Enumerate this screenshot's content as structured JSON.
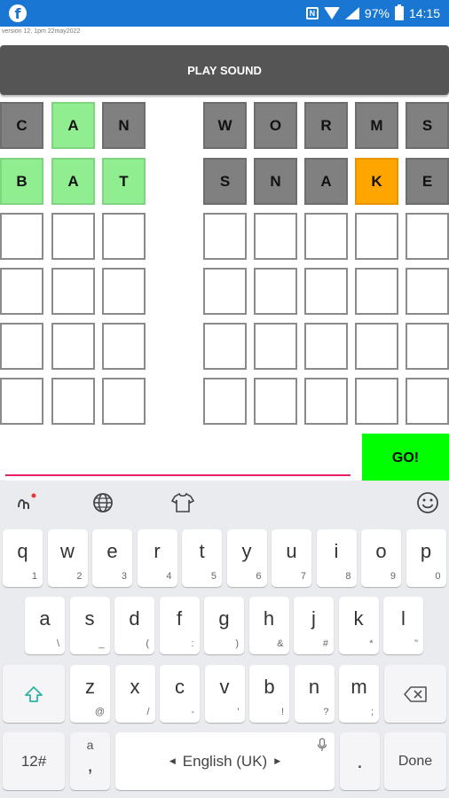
{
  "status": {
    "app_icon": "facebook-icon",
    "battery": "97%",
    "time": "14:15"
  },
  "version": "version 12, 1pm 22may2022",
  "play_label": "PLAY SOUND",
  "left_grid": [
    [
      {
        "l": "C",
        "c": "gray"
      },
      {
        "l": "A",
        "c": "green"
      },
      {
        "l": "N",
        "c": "gray"
      }
    ],
    [
      {
        "l": "B",
        "c": "green"
      },
      {
        "l": "A",
        "c": "green"
      },
      {
        "l": "T",
        "c": "green"
      }
    ],
    [
      {
        "l": "",
        "c": "empty"
      },
      {
        "l": "",
        "c": "empty"
      },
      {
        "l": "",
        "c": "empty"
      }
    ],
    [
      {
        "l": "",
        "c": "empty"
      },
      {
        "l": "",
        "c": "empty"
      },
      {
        "l": "",
        "c": "empty"
      }
    ],
    [
      {
        "l": "",
        "c": "empty"
      },
      {
        "l": "",
        "c": "empty"
      },
      {
        "l": "",
        "c": "empty"
      }
    ],
    [
      {
        "l": "",
        "c": "empty"
      },
      {
        "l": "",
        "c": "empty"
      },
      {
        "l": "",
        "c": "empty"
      }
    ]
  ],
  "right_grid": [
    [
      {
        "l": "W",
        "c": "gray"
      },
      {
        "l": "O",
        "c": "gray"
      },
      {
        "l": "R",
        "c": "gray"
      },
      {
        "l": "M",
        "c": "gray"
      },
      {
        "l": "S",
        "c": "gray"
      }
    ],
    [
      {
        "l": "S",
        "c": "gray"
      },
      {
        "l": "N",
        "c": "gray"
      },
      {
        "l": "A",
        "c": "gray"
      },
      {
        "l": "K",
        "c": "orange"
      },
      {
        "l": "E",
        "c": "gray"
      }
    ],
    [
      {
        "l": "",
        "c": "empty"
      },
      {
        "l": "",
        "c": "empty"
      },
      {
        "l": "",
        "c": "empty"
      },
      {
        "l": "",
        "c": "empty"
      },
      {
        "l": "",
        "c": "empty"
      }
    ],
    [
      {
        "l": "",
        "c": "empty"
      },
      {
        "l": "",
        "c": "empty"
      },
      {
        "l": "",
        "c": "empty"
      },
      {
        "l": "",
        "c": "empty"
      },
      {
        "l": "",
        "c": "empty"
      }
    ],
    [
      {
        "l": "",
        "c": "empty"
      },
      {
        "l": "",
        "c": "empty"
      },
      {
        "l": "",
        "c": "empty"
      },
      {
        "l": "",
        "c": "empty"
      },
      {
        "l": "",
        "c": "empty"
      }
    ],
    [
      {
        "l": "",
        "c": "empty"
      },
      {
        "l": "",
        "c": "empty"
      },
      {
        "l": "",
        "c": "empty"
      },
      {
        "l": "",
        "c": "empty"
      },
      {
        "l": "",
        "c": "empty"
      }
    ]
  ],
  "go_label": "GO!",
  "colors": {
    "gray": "#808080",
    "green": "#90ee90",
    "orange": "#ffa500",
    "go": "#00ff00",
    "status_bar": "#1976d2"
  },
  "keyboard": {
    "toolbar": [
      "touch-input-icon",
      "globe-icon",
      "theme-shirt-icon",
      "emoji-icon"
    ],
    "row1": [
      [
        "q",
        "1"
      ],
      [
        "w",
        "2"
      ],
      [
        "e",
        "3"
      ],
      [
        "r",
        "4"
      ],
      [
        "t",
        "5"
      ],
      [
        "y",
        "6"
      ],
      [
        "u",
        "7"
      ],
      [
        "i",
        "8"
      ],
      [
        "o",
        "9"
      ],
      [
        "p",
        "0"
      ]
    ],
    "row2": [
      [
        "a",
        "\\"
      ],
      [
        "s",
        "_"
      ],
      [
        "d",
        "("
      ],
      [
        "f",
        ":"
      ],
      [
        "g",
        ")"
      ],
      [
        "h",
        "&"
      ],
      [
        "j",
        "#"
      ],
      [
        "k",
        "*"
      ],
      [
        "l",
        "\""
      ]
    ],
    "row3": [
      [
        "z",
        "@"
      ],
      [
        "x",
        "/"
      ],
      [
        "c",
        "-"
      ],
      [
        "v",
        "'"
      ],
      [
        "b",
        "!"
      ],
      [
        "n",
        "?"
      ],
      [
        "m",
        ";"
      ]
    ],
    "shift_icon": "shift-icon",
    "backspace_icon": "backspace-icon",
    "symbols_label": "12#",
    "comma_top": "a",
    "comma_label": ",",
    "space_label": "English (UK)",
    "period_label": ".",
    "done_label": "Done"
  }
}
